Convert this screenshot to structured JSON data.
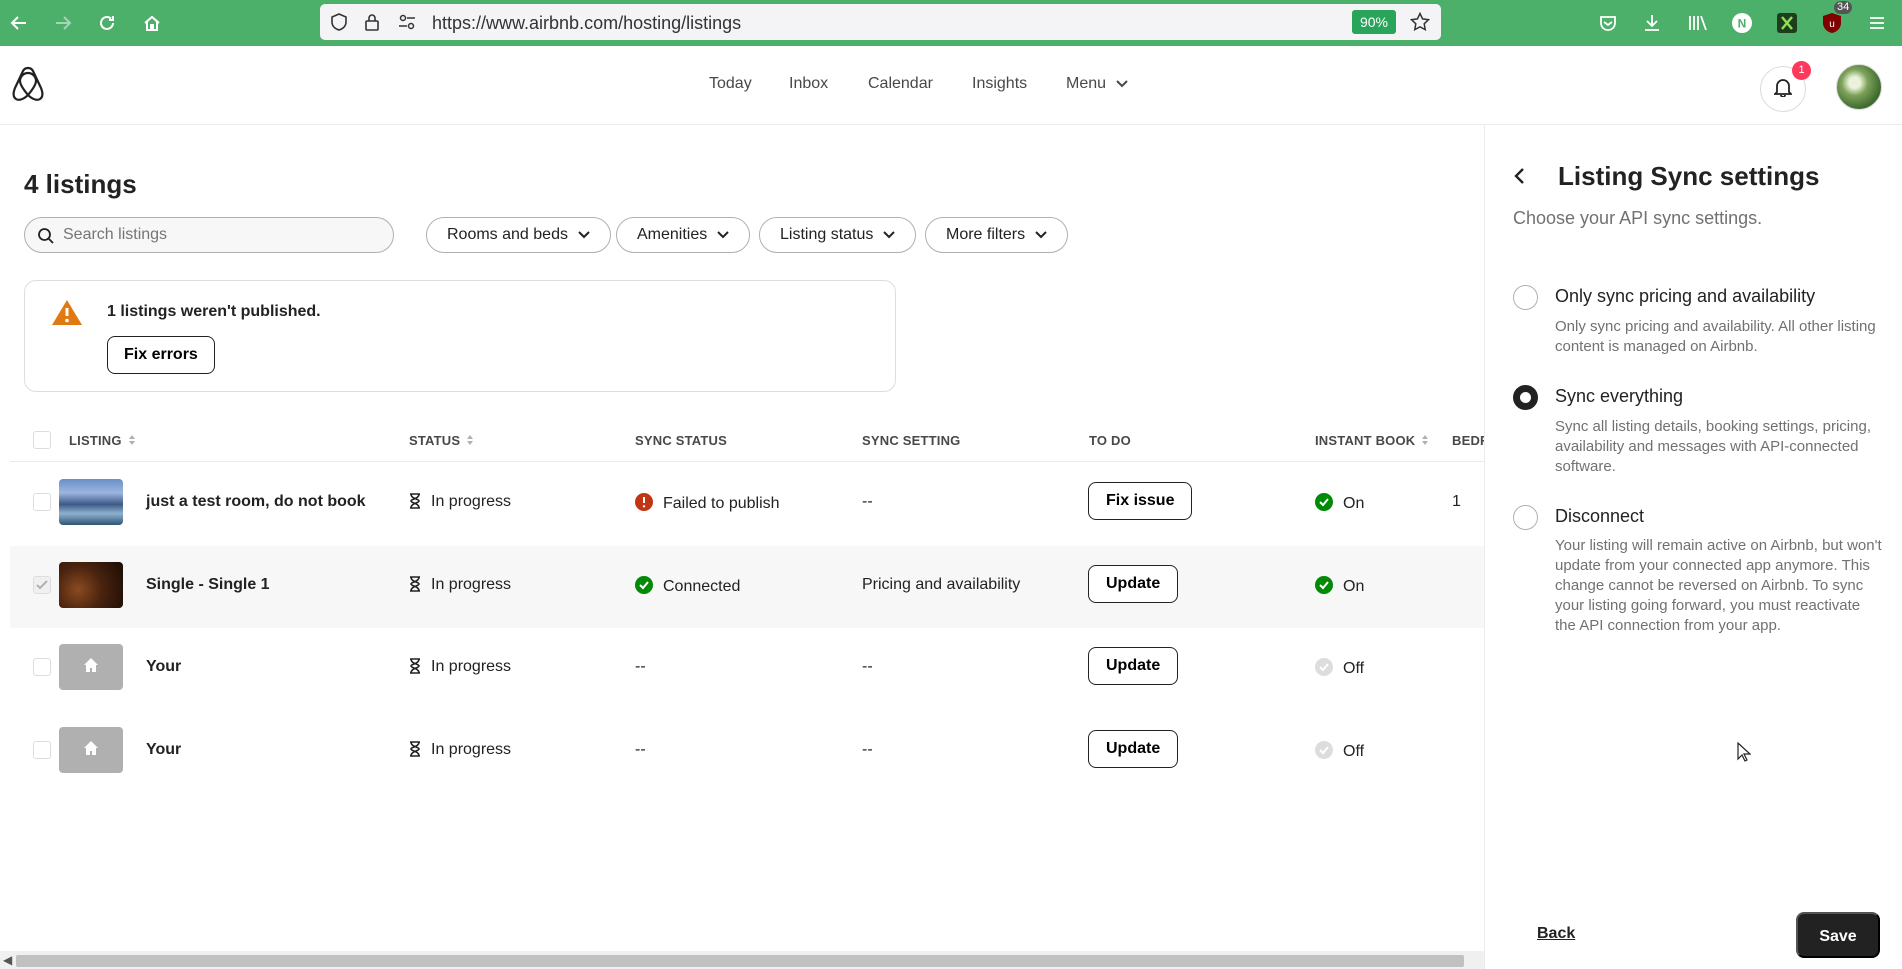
{
  "browser": {
    "url": "https://www.airbnb.com/hosting/listings",
    "zoom": "90%",
    "toolbar_badge": "34"
  },
  "header": {
    "nav": [
      "Today",
      "Inbox",
      "Calendar",
      "Insights",
      "Menu"
    ],
    "notification_count": "1"
  },
  "main": {
    "title": "4 listings",
    "search_placeholder": "Search listings",
    "filters": [
      "Rooms and beds",
      "Amenities",
      "Listing status",
      "More filters"
    ],
    "alert": {
      "message": "1 listings weren't published.",
      "button": "Fix errors"
    },
    "columns": [
      "LISTING",
      "STATUS",
      "SYNC STATUS",
      "SYNC SETTING",
      "TO DO",
      "INSTANT BOOK",
      "BEDF"
    ],
    "rows": [
      {
        "name": "just a test room, do not book",
        "status": "In progress",
        "sync_status": "Failed to publish",
        "sync_setting": "--",
        "todo": "Fix issue",
        "instant_book": "On",
        "bedrooms": "1",
        "thumb": "photo-room",
        "sync_status_icon": "error-icon",
        "selected": false
      },
      {
        "name": "Single - Single 1",
        "status": "In progress",
        "sync_status": "Connected",
        "sync_setting": "Pricing and availability",
        "todo": "Update",
        "instant_book": "On",
        "bedrooms": "",
        "thumb": "photo-room",
        "sync_status_icon": "check-circle-icon",
        "selected": true
      },
      {
        "name": "Your",
        "status": "In progress",
        "sync_status": "--",
        "sync_setting": "--",
        "todo": "Update",
        "instant_book": "Off",
        "bedrooms": "",
        "thumb": "home-icon",
        "sync_status_icon": "",
        "selected": false
      },
      {
        "name": "Your",
        "status": "In progress",
        "sync_status": "--",
        "sync_setting": "--",
        "todo": "Update",
        "instant_book": "Off",
        "bedrooms": "",
        "thumb": "home-icon",
        "sync_status_icon": "",
        "selected": false
      }
    ]
  },
  "panel": {
    "title": "Listing Sync settings",
    "subtitle": "Choose your API sync settings.",
    "options": [
      {
        "title": "Only sync pricing and availability",
        "desc": "Only sync pricing and availability. All other listing content is managed on Airbnb.",
        "selected": false
      },
      {
        "title": "Sync everything",
        "desc": "Sync all listing details, booking settings, pricing, availability and messages with API-connected software.",
        "selected": true
      },
      {
        "title": "Disconnect",
        "desc": "Your listing will remain active on Airbnb, but won't update from your connected app anymore. This change cannot be reversed on Airbnb. To sync your listing going forward, you must reactivate the API connection from your app.",
        "selected": false
      }
    ],
    "back_label": "Back",
    "save_label": "Save"
  },
  "colors": {
    "browser_bar": "#4caf6a",
    "brand": "#ff385c",
    "success": "#008a05",
    "error": "#c13515",
    "warning": "#e07912"
  }
}
